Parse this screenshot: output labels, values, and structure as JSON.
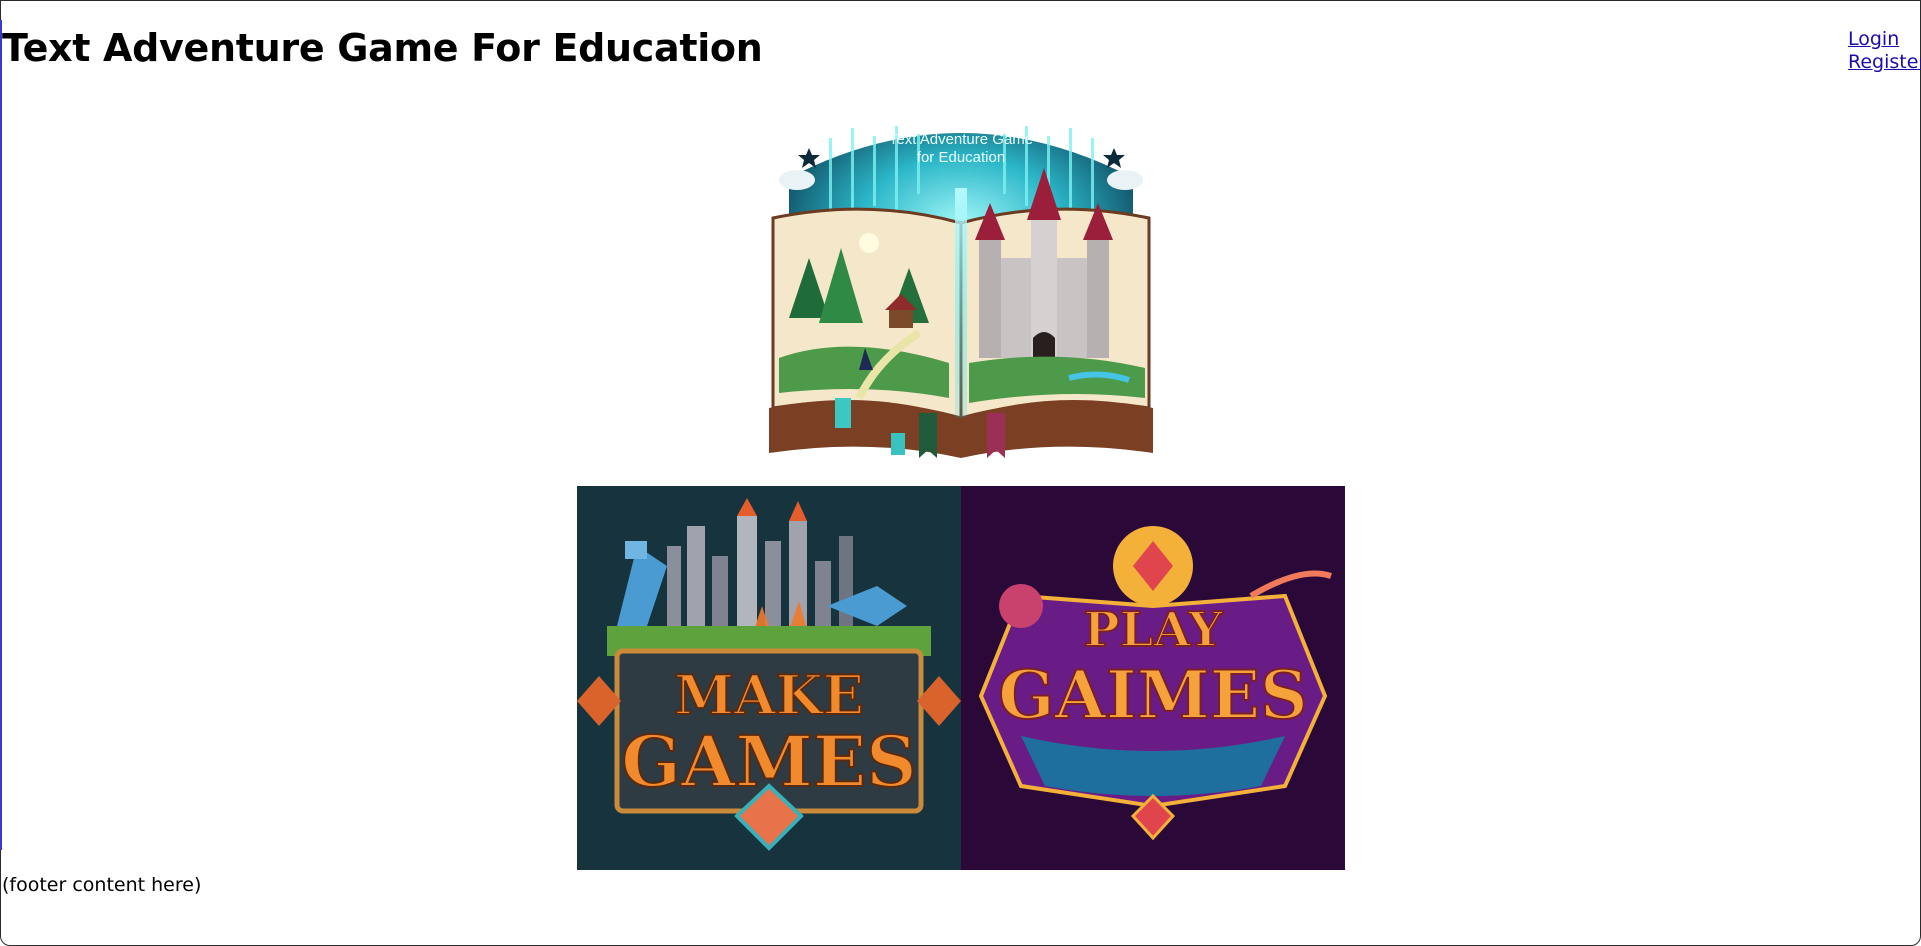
{
  "header": {
    "title": "Text Adventure Game For Education",
    "login_label": "Login",
    "register_label": "Register"
  },
  "hero": {
    "banner_text_line1": "Text Adventure Game",
    "banner_text_line2": "for Education"
  },
  "cards": {
    "make": {
      "line1": "MAKE",
      "line2": "GAMES"
    },
    "play": {
      "line1": "PLAY",
      "line2": "GAIMES"
    }
  },
  "footer": {
    "text": "(footer content here)"
  },
  "colors": {
    "link": "#1a0dab",
    "make_bg": "#17333d",
    "play_bg": "#2a0838",
    "title_orange": "#f08a2c",
    "teal_glow": "#39e0e8"
  }
}
